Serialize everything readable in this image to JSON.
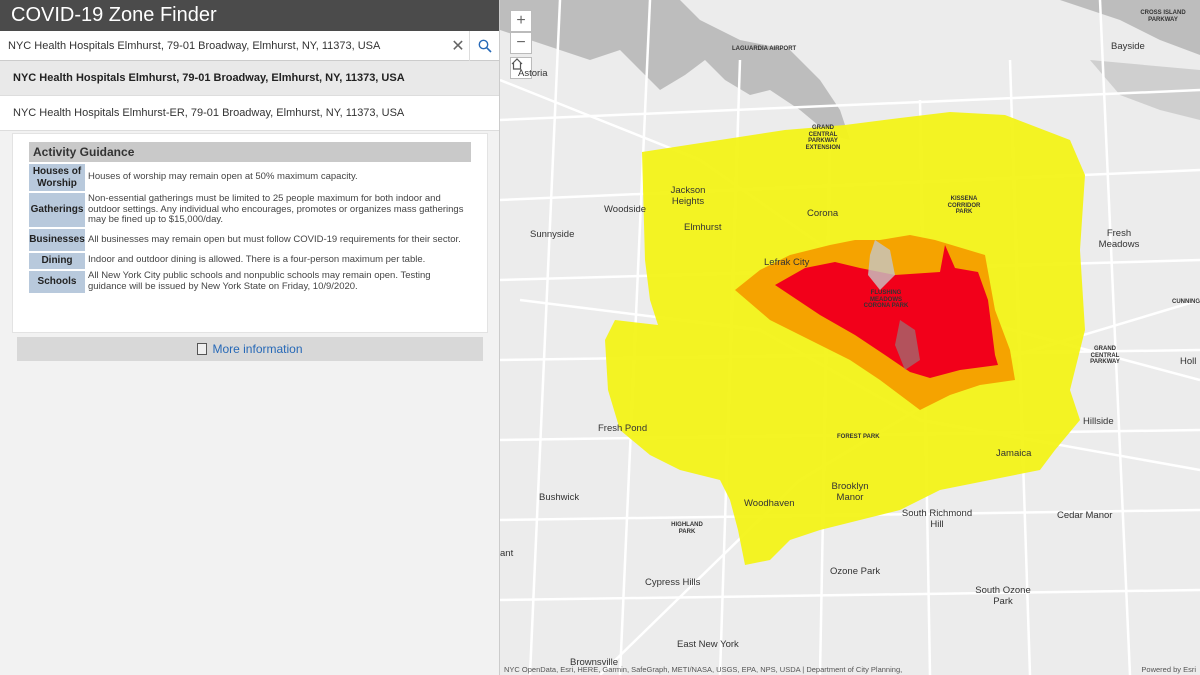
{
  "app": {
    "title": "COVID-19 Zone Finder"
  },
  "search": {
    "value": "NYC Health Hospitals Elmhurst, 79-01 Broadway, Elmhurst, NY, 11373, USA",
    "suggestions": [
      "NYC Health Hospitals Elmhurst, 79-01 Broadway, Elmhurst, NY, 11373, USA",
      "NYC Health Hospitals Elmhurst-ER, 79-01 Broadway, Elmhurst, NY, 11373, USA"
    ]
  },
  "guidance": {
    "title": "Activity Guidance",
    "rows": [
      {
        "label": "Houses of Worship",
        "text": "Houses of worship may remain open at 50% maximum capacity."
      },
      {
        "label": "Gatherings",
        "text": "Non-essential gatherings must be limited to 25 people maximum for both indoor and outdoor settings. Any individual who encourages, promotes or organizes mass gatherings may be fined up to $15,000/day."
      },
      {
        "label": "Businesses",
        "text": "All businesses may remain open but must follow COVID-19 requirements for their sector."
      },
      {
        "label": "Dining",
        "text": "Indoor and outdoor dining is allowed. There is a four-person maximum per table."
      },
      {
        "label": "Schools",
        "text": "All New York City public schools and nonpublic schools may remain open. Testing guidance will be issued by New York State on Friday, 10/9/2020."
      }
    ]
  },
  "more_info": "More information",
  "map": {
    "zoom_in": "+",
    "zoom_out": "−",
    "labels": {
      "laguardia": "LAGUARDIA AIRPORT",
      "grand_central_ext": "GRAND CENTRAL PARKWAY EXTENSION",
      "cross_island": "CROSS ISLAND PARKWAY",
      "bayside": "Bayside",
      "astoria": "Astoria",
      "jackson_heights": "Jackson Heights",
      "woodside": "Woodside",
      "corona": "Corona",
      "kissena": "KISSENA CORRIDOR PARK",
      "fresh_meadows": "Fresh Meadows",
      "sunnyside": "Sunnyside",
      "elmhurst": "Elmhurst",
      "lefrak": "Lefrak City",
      "flushing_meadows": "FLUSHING MEADOWS CORONA PARK",
      "cunning": "CUNNING",
      "grand_central": "GRAND CENTRAL PARKWAY",
      "holl": "Holl",
      "fresh_pond": "Fresh Pond",
      "forest_park": "FOREST PARK",
      "hillside": "Hillside",
      "jamaica": "Jamaica",
      "bushwick": "Bushwick",
      "brooklyn_manor": "Brooklyn Manor",
      "woodhaven": "Woodhaven",
      "highland_park": "HIGHLAND PARK",
      "south_richmond_hill": "South Richmond Hill",
      "cedar_manor": "Cedar Manor",
      "ant": "ant",
      "ozone_park": "Ozone Park",
      "cypress_hills": "Cypress Hills",
      "south_ozone_park": "South Ozone Park",
      "east_new_york": "East New York",
      "brownsville": "Brownsville"
    },
    "attribution": "NYC OpenData, Esri, HERE, Garmin, SafeGraph, METI/NASA, USGS, EPA, NPS, USDA | Department of City Planning,",
    "powered_by": "Powered by Esri",
    "colors": {
      "yellow_zone": "#f3f318",
      "orange_zone": "#f5a300",
      "red_zone": "#f2001a",
      "water": "#bdbdbd"
    }
  }
}
